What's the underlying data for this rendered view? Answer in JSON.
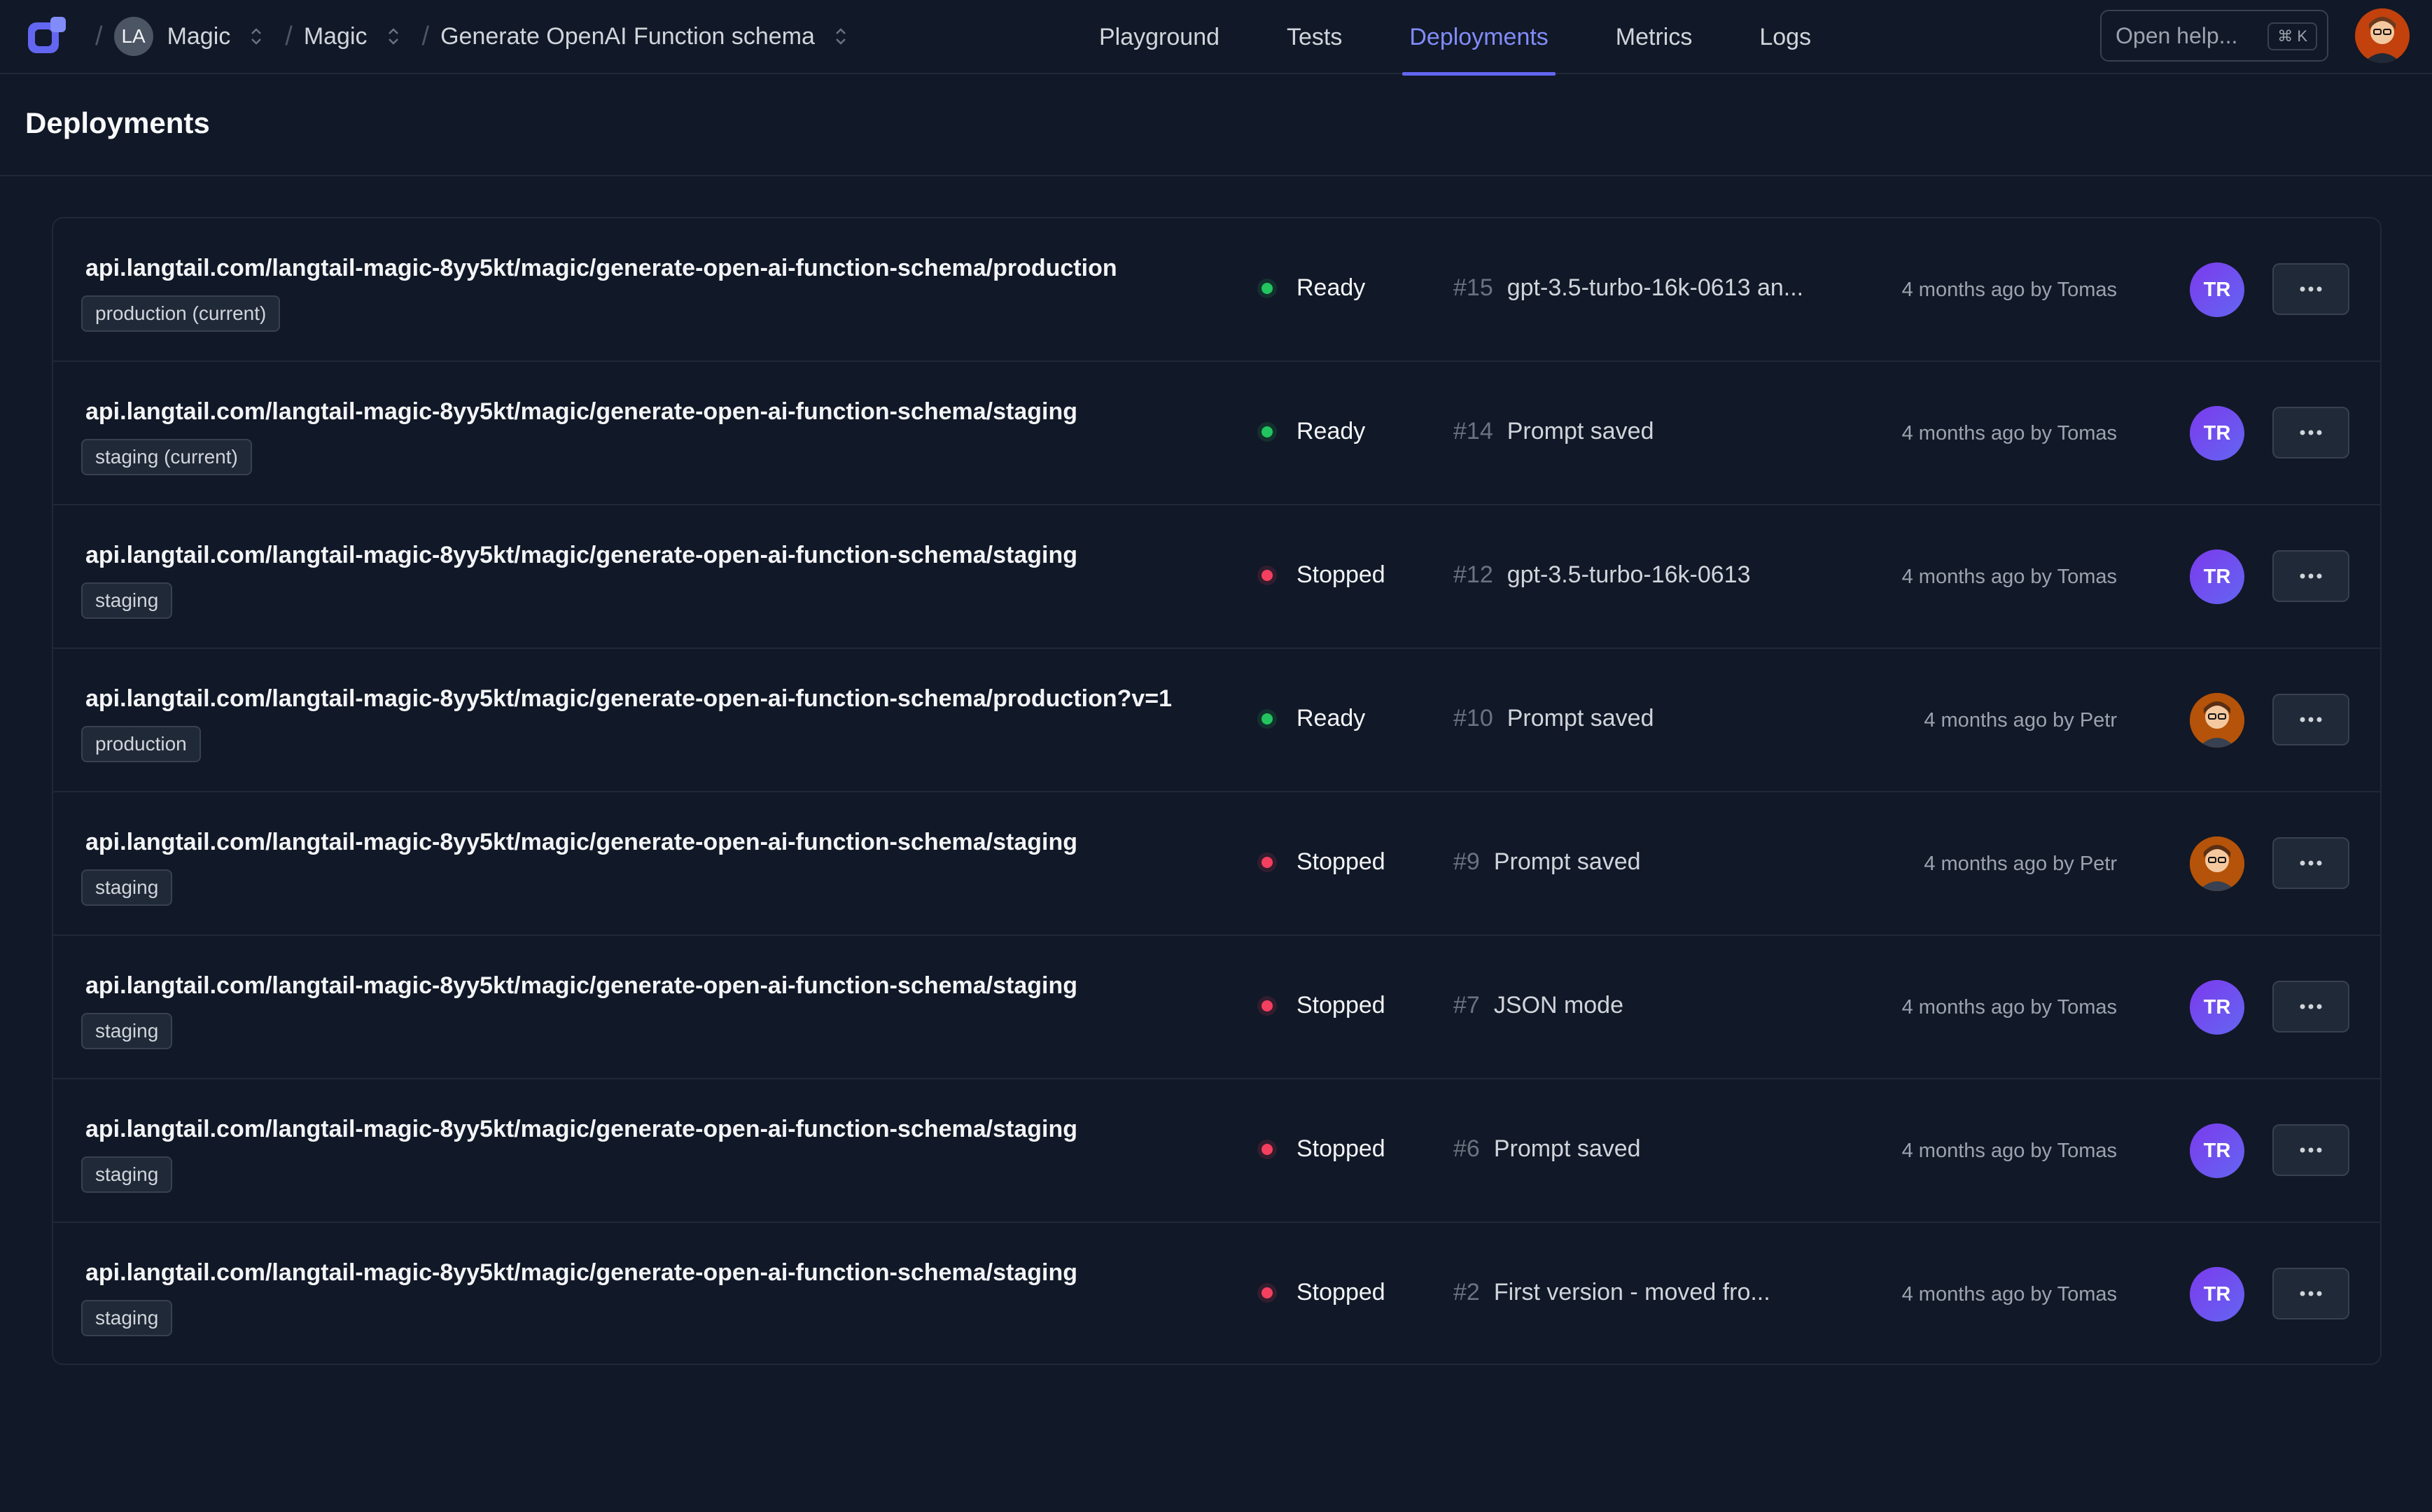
{
  "header": {
    "workspace_initials": "LA",
    "breadcrumbs": [
      "Magic",
      "Magic",
      "Generate OpenAI Function schema"
    ],
    "tabs": [
      {
        "label": "Playground",
        "active": false
      },
      {
        "label": "Tests",
        "active": false
      },
      {
        "label": "Deployments",
        "active": true
      },
      {
        "label": "Metrics",
        "active": false
      },
      {
        "label": "Logs",
        "active": false
      }
    ],
    "help_placeholder": "Open help...",
    "help_shortcut": "⌘ K"
  },
  "page": {
    "title": "Deployments"
  },
  "deployments": [
    {
      "url": "api.langtail.com/langtail-magic-8yy5kt/magic/generate-open-ai-function-schema/production",
      "tag": "production (current)",
      "status": "Ready",
      "version": "#15",
      "message": "gpt-3.5-turbo-16k-0613 an...",
      "when": "4 months ago by Tomas",
      "author_initials": "TR",
      "avatar": "initials"
    },
    {
      "url": "api.langtail.com/langtail-magic-8yy5kt/magic/generate-open-ai-function-schema/staging",
      "tag": "staging (current)",
      "status": "Ready",
      "version": "#14",
      "message": "Prompt saved",
      "when": "4 months ago by Tomas",
      "author_initials": "TR",
      "avatar": "initials"
    },
    {
      "url": "api.langtail.com/langtail-magic-8yy5kt/magic/generate-open-ai-function-schema/staging",
      "tag": "staging",
      "status": "Stopped",
      "version": "#12",
      "message": "gpt-3.5-turbo-16k-0613",
      "when": "4 months ago by Tomas",
      "author_initials": "TR",
      "avatar": "initials"
    },
    {
      "url": "api.langtail.com/langtail-magic-8yy5kt/magic/generate-open-ai-function-schema/production?v=1",
      "tag": "production",
      "status": "Ready",
      "version": "#10",
      "message": "Prompt saved",
      "when": "4 months ago by Petr",
      "author_initials": "",
      "avatar": "photo"
    },
    {
      "url": "api.langtail.com/langtail-magic-8yy5kt/magic/generate-open-ai-function-schema/staging",
      "tag": "staging",
      "status": "Stopped",
      "version": "#9",
      "message": "Prompt saved",
      "when": "4 months ago by Petr",
      "author_initials": "",
      "avatar": "photo"
    },
    {
      "url": "api.langtail.com/langtail-magic-8yy5kt/magic/generate-open-ai-function-schema/staging",
      "tag": "staging",
      "status": "Stopped",
      "version": "#7",
      "message": "JSON mode",
      "when": "4 months ago by Tomas",
      "author_initials": "TR",
      "avatar": "initials"
    },
    {
      "url": "api.langtail.com/langtail-magic-8yy5kt/magic/generate-open-ai-function-schema/staging",
      "tag": "staging",
      "status": "Stopped",
      "version": "#6",
      "message": "Prompt saved",
      "when": "4 months ago by Tomas",
      "author_initials": "TR",
      "avatar": "initials"
    },
    {
      "url": "api.langtail.com/langtail-magic-8yy5kt/magic/generate-open-ai-function-schema/staging",
      "tag": "staging",
      "status": "Stopped",
      "version": "#2",
      "message": "First version - moved fro...",
      "when": "4 months ago by Tomas",
      "author_initials": "TR",
      "avatar": "initials"
    }
  ],
  "icons": {
    "logo": "langtail-logo-icon",
    "more": "more-horizontal-icon",
    "chevron": "chevron-up-down-icon"
  },
  "colors": {
    "background": "#111827",
    "accent": "#818cf8",
    "ready": "#22c55e",
    "stopped": "#f43f5e"
  }
}
